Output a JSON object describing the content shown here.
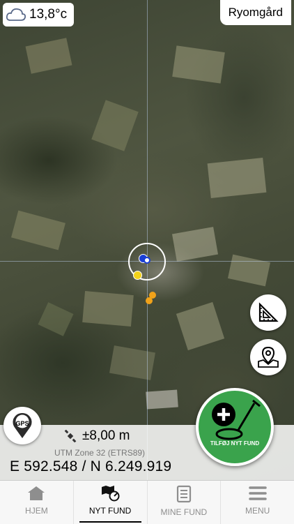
{
  "weather": {
    "icon": "cloud-icon",
    "temperature": "13,8°c"
  },
  "location": {
    "name": "Ryomgård"
  },
  "position": {
    "accuracy": "±8,00 m",
    "zone": "UTM Zone 32 (ETRS89)",
    "coordinates": "E 592.548 / N 6.249.919"
  },
  "buttons": {
    "gps_label": "GPS",
    "add_find_label": "TILFØJ NYT FUND"
  },
  "tabs": [
    {
      "label": "HJEM",
      "icon": "home-icon",
      "active": false
    },
    {
      "label": "NYT FUND",
      "icon": "map-compass-icon",
      "active": true
    },
    {
      "label": "MINE FUND",
      "icon": "list-document-icon",
      "active": false
    },
    {
      "label": "MENU",
      "icon": "menu-icon",
      "active": false
    }
  ],
  "colors": {
    "accent_green": "#3aa34c",
    "marker_blue": "#1a3fd6",
    "marker_yellow": "#f2d21b",
    "marker_orange": "#f0a21a"
  }
}
